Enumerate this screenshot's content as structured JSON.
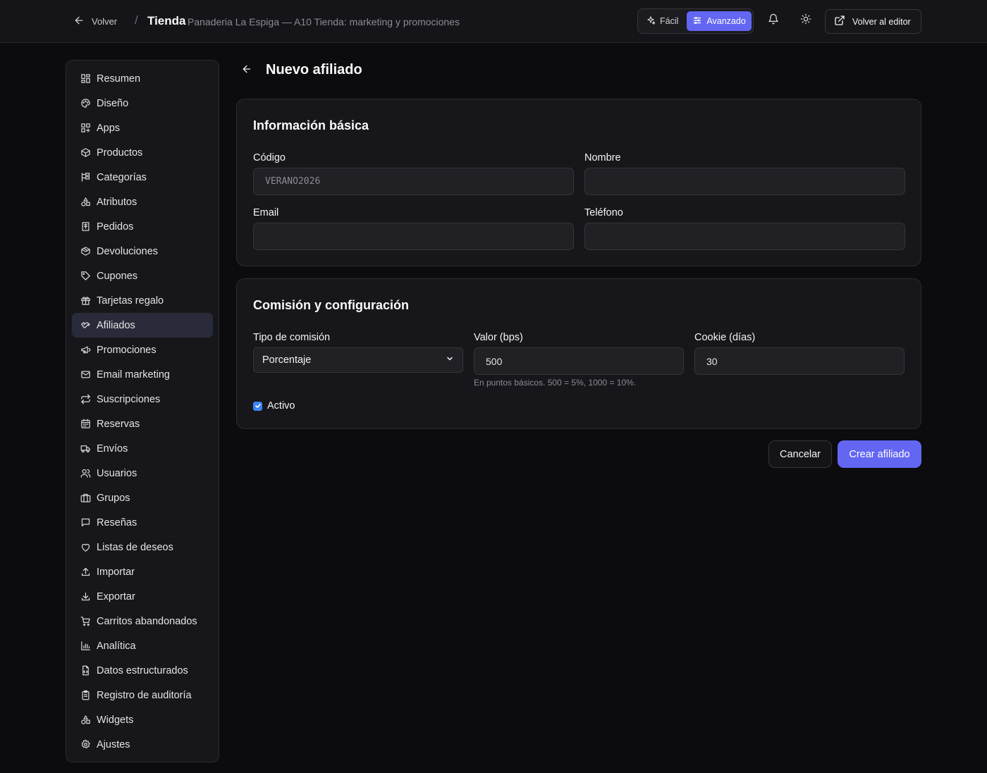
{
  "topbar": {
    "back_label": "Volver",
    "separator": "/",
    "store_title": "Tienda",
    "store_subtitle": "Panaderia La Espiga — A10 Tienda: marketing y promociones",
    "mode_easy": "Fácil",
    "mode_advanced": "Avanzado",
    "mode_selected": "Avanzado",
    "editor_button": "Volver al editor"
  },
  "sidebar": {
    "active": "Afiliados",
    "items": [
      {
        "label": "Resumen",
        "icon": "grid-icon"
      },
      {
        "label": "Diseño",
        "icon": "palette-icon"
      },
      {
        "label": "Apps",
        "icon": "apps-icon"
      },
      {
        "label": "Productos",
        "icon": "box-icon"
      },
      {
        "label": "Categorías",
        "icon": "tree-icon"
      },
      {
        "label": "Atributos",
        "icon": "shapes-icon"
      },
      {
        "label": "Pedidos",
        "icon": "receipt-icon"
      },
      {
        "label": "Devoluciones",
        "icon": "package-icon"
      },
      {
        "label": "Cupones",
        "icon": "tag-icon"
      },
      {
        "label": "Tarjetas regalo",
        "icon": "gift-icon"
      },
      {
        "label": "Afiliados",
        "icon": "handshake-icon"
      },
      {
        "label": "Promociones",
        "icon": "megaphone-icon"
      },
      {
        "label": "Email marketing",
        "icon": "mail-icon"
      },
      {
        "label": "Suscripciones",
        "icon": "repeat-icon"
      },
      {
        "label": "Reservas",
        "icon": "calendar-icon"
      },
      {
        "label": "Envíos",
        "icon": "truck-icon"
      },
      {
        "label": "Usuarios",
        "icon": "users-icon"
      },
      {
        "label": "Grupos",
        "icon": "briefcase-icon"
      },
      {
        "label": "Reseñas",
        "icon": "message-icon"
      },
      {
        "label": "Listas de deseos",
        "icon": "heart-icon"
      },
      {
        "label": "Importar",
        "icon": "upload-icon"
      },
      {
        "label": "Exportar",
        "icon": "download-icon"
      },
      {
        "label": "Carritos abandonados",
        "icon": "cart-icon"
      },
      {
        "label": "Analítica",
        "icon": "bar-chart-icon"
      },
      {
        "label": "Datos estructurados",
        "icon": "file-code-icon"
      },
      {
        "label": "Registro de auditoría",
        "icon": "clipboard-icon"
      },
      {
        "label": "Widgets",
        "icon": "shapes-icon"
      },
      {
        "label": "Ajustes",
        "icon": "gear-icon"
      }
    ]
  },
  "page": {
    "title": "Nuevo afiliado"
  },
  "basic_info": {
    "title": "Información básica",
    "code_label": "Código",
    "code_placeholder": "VERANO2026",
    "code_value": "",
    "name_label": "Nombre",
    "name_value": "",
    "email_label": "Email",
    "email_value": "",
    "phone_label": "Teléfono",
    "phone_value": ""
  },
  "commission": {
    "title": "Comisión y configuración",
    "type_label": "Tipo de comisión",
    "type_value": "Porcentaje",
    "value_label": "Valor (bps)",
    "value_value": "500",
    "value_hint": "En puntos básicos. 500 = 5%, 1000 = 10%.",
    "cookie_label": "Cookie (días)",
    "cookie_value": "30",
    "active_label": "Activo",
    "active_checked": true
  },
  "actions": {
    "cancel": "Cancelar",
    "create": "Crear afiliado"
  },
  "colors": {
    "accent": "#6366f1",
    "checkbox": "#3b82f6",
    "background": "#0c0c0f",
    "card": "#17171b"
  }
}
